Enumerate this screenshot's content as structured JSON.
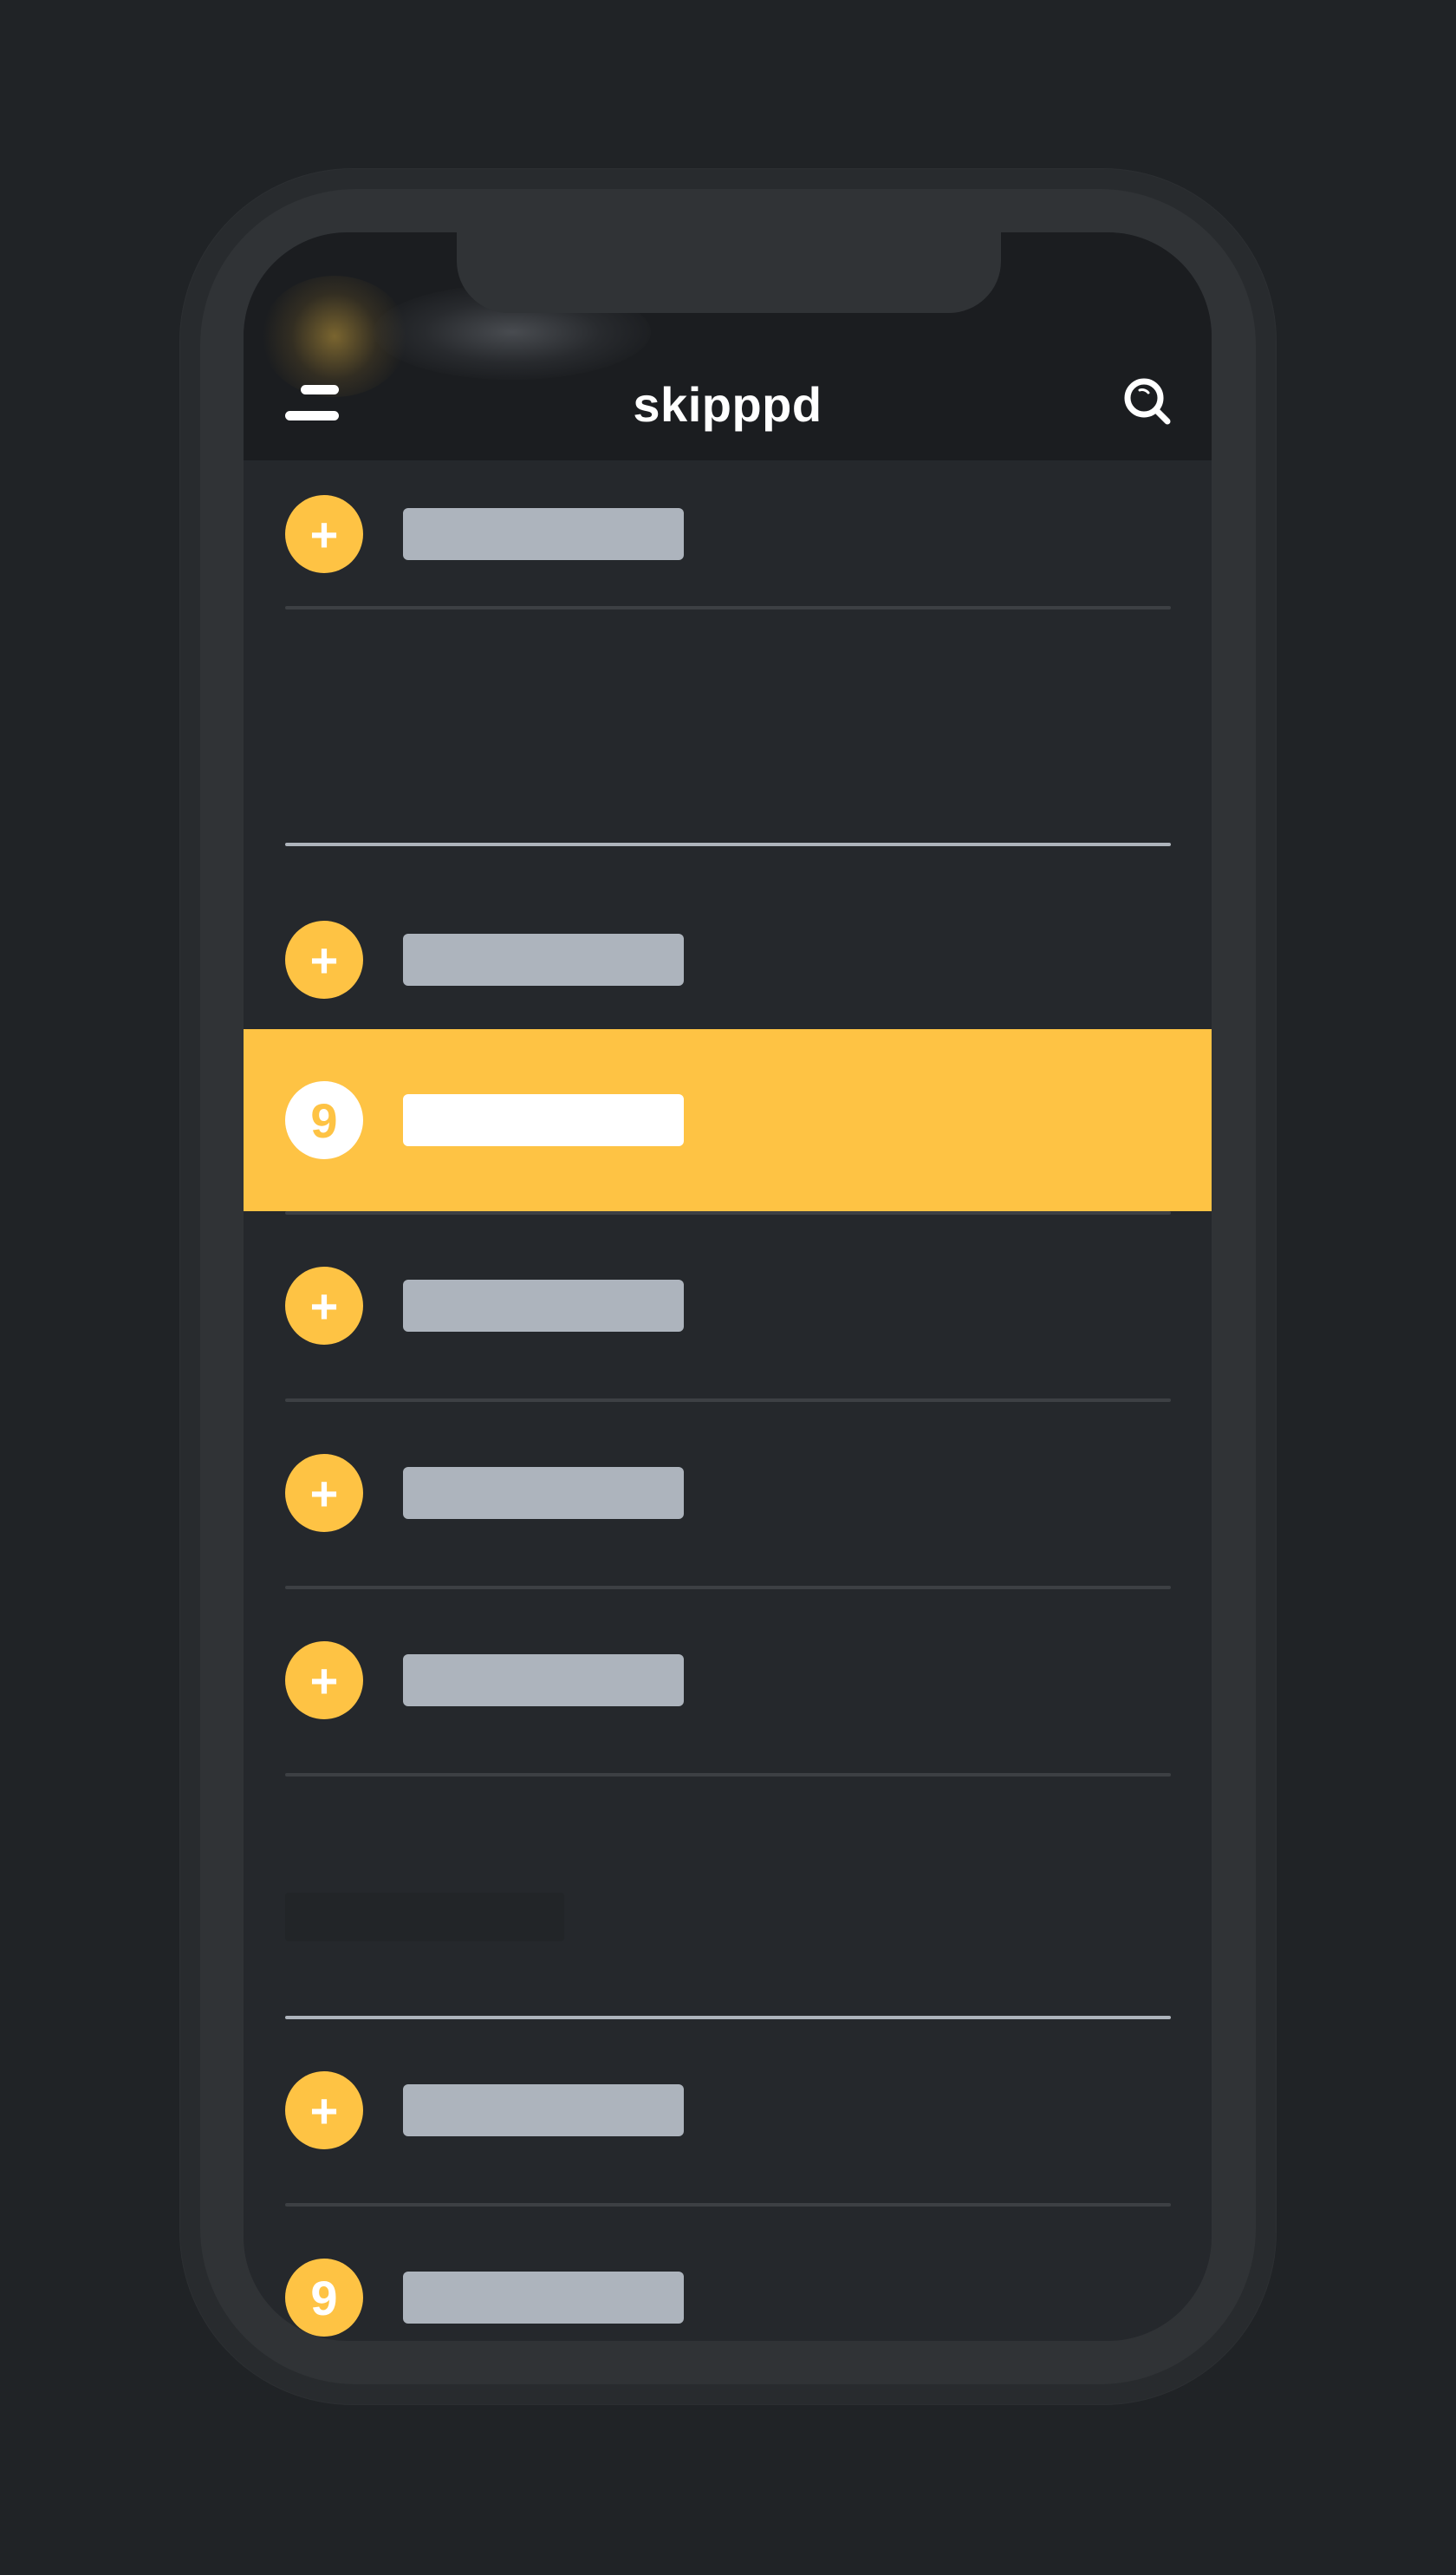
{
  "app": {
    "title": "skipppd"
  },
  "header": {
    "menu_icon": "hamburger-menu-icon",
    "search_icon": "search-icon"
  },
  "list": {
    "add_symbol": "+",
    "number_symbol": "9"
  },
  "colors": {
    "accent": "#fec344",
    "background": "#202326",
    "screen": "#25282c",
    "header": "#1b1d20",
    "placeholder": "#adb4bd",
    "divider": "#3d4044"
  }
}
